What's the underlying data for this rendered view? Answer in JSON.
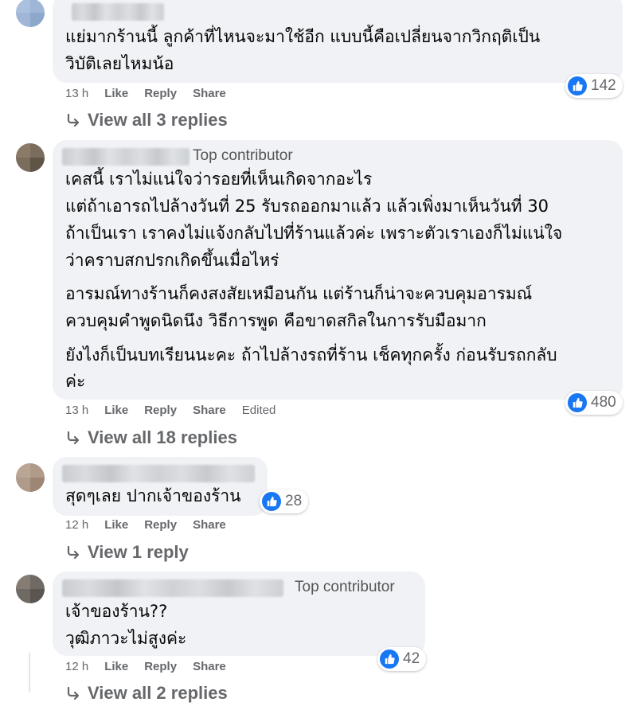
{
  "comments": [
    {
      "text_lines": [
        "แย่มากร้านนี้ ลูกค้าที่ไหนจะมาใช้อีก แบบนี้คือเปลี่ยนจากวิกฤติเป็น",
        "วิบัติเลยไหมน้อ"
      ],
      "reactions": "142",
      "time": "13 h",
      "actions": [
        "Like",
        "Reply",
        "Share"
      ],
      "replies": "View all 3 replies"
    },
    {
      "badge": "Top contributor",
      "para1": [
        "เคสนี้ เราไม่แน่ใจว่ารอยที่เห็นเกิดจากอะไร",
        "แต่ถ้าเอารถไปล้างวันที่ 25 รับรถออกมาแล้ว แล้วเพิ่งมาเห็นวันที่ 30",
        "ถ้าเป็นเรา เราคงไม่แจ้งกลับไปที่ร้านแล้วค่ะ เพราะตัวเราเองก็ไม่แน่ใจ",
        "ว่าคราบสกปรกเกิดขึ้นเมื่อไหร่"
      ],
      "para2": [
        "อารมณ์ทางร้านก็คงสงสัยเหมือนกัน แต่ร้านก็น่าจะควบคุมอารมณ์",
        "ควบคุมคำพูดนิดนึง วิธีการพูด คือขาดสกิลในการรับมือมาก"
      ],
      "para3": [
        "ยังไงก็เป็นบทเรียนนะคะ ถ้าไปล้างรถที่ร้าน เช็คทุกครั้ง ก่อนรับรถกลับ",
        "ค่ะ"
      ],
      "reactions": "480",
      "time": "13 h",
      "actions": [
        "Like",
        "Reply",
        "Share"
      ],
      "edited": "Edited",
      "replies": "View all 18 replies"
    },
    {
      "text_lines": [
        "สุดๆเลย ปากเจ้าของร้าน"
      ],
      "reactions": "28",
      "time": "12 h",
      "actions": [
        "Like",
        "Reply",
        "Share"
      ],
      "replies": "View 1 reply"
    },
    {
      "badge": "Top contributor",
      "text_lines": [
        "เจ้าของร้าน??",
        "วุฒิภาวะไม่สูงค่ะ"
      ],
      "reactions": "42",
      "time": "12 h",
      "actions": [
        "Like",
        "Reply",
        "Share"
      ],
      "replies": "View all 2 replies"
    }
  ],
  "colors": {
    "bubble": "#f0f2f5",
    "like_blue": "#1877f2",
    "meta_gray": "#65676b"
  },
  "icons": {
    "reaction": "thumbs-up-icon",
    "reply_arrow": "reply-arrow-icon"
  }
}
